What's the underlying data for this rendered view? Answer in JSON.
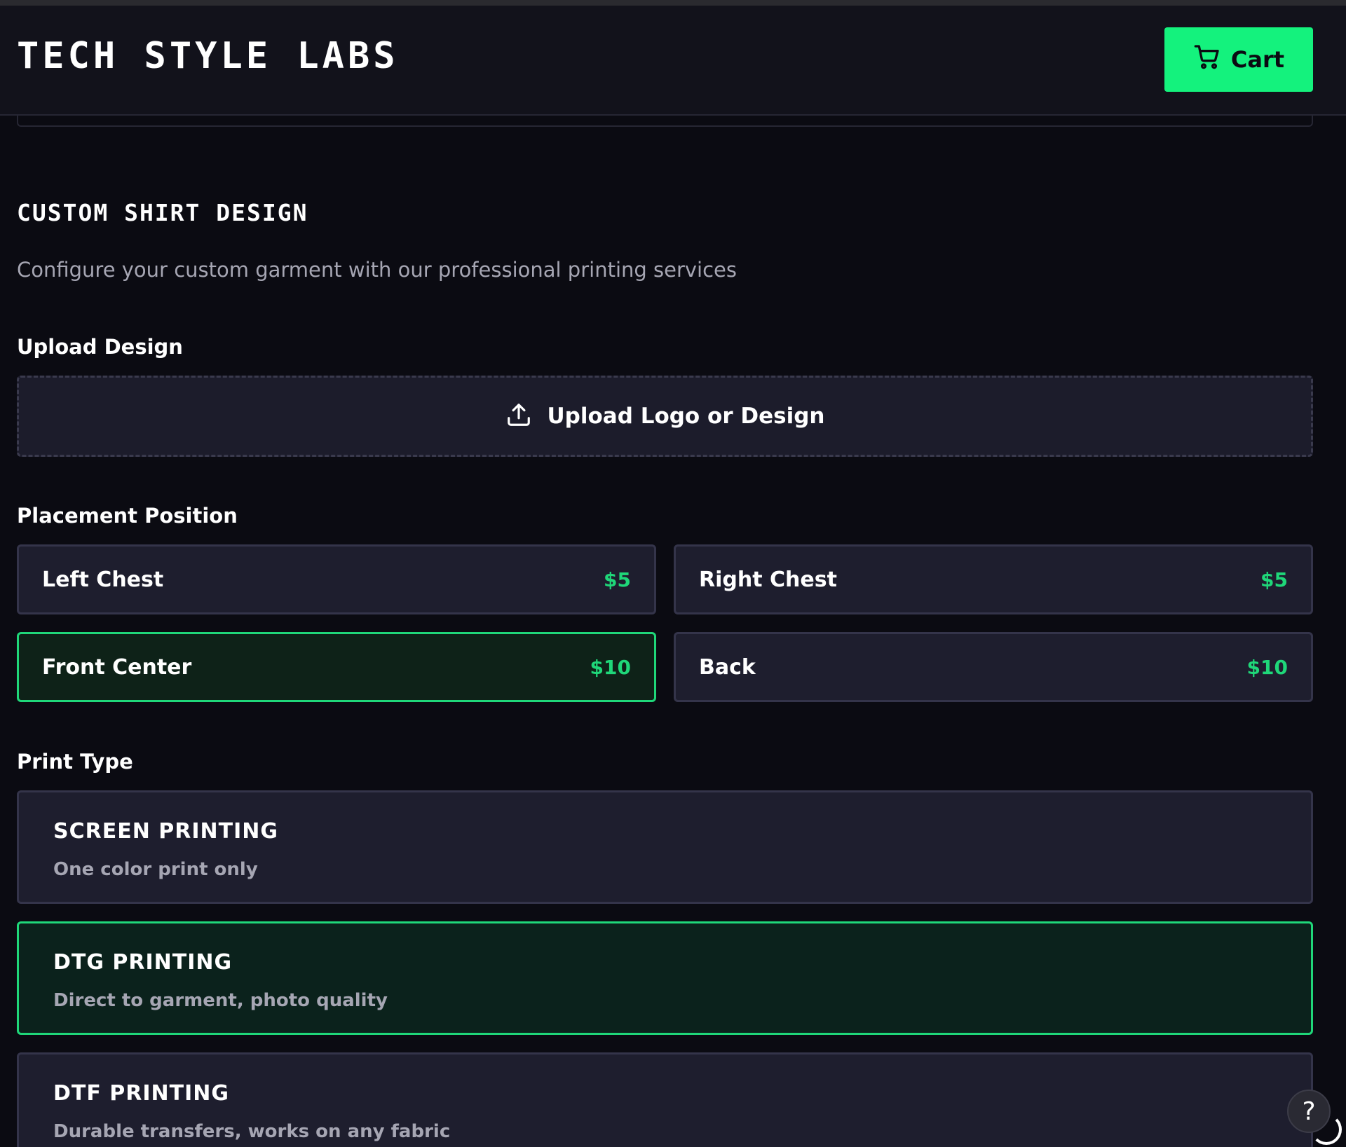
{
  "header": {
    "brand": "TECH STYLE LABS",
    "cart_label": "Cart",
    "cart_icon": "shopping-cart-icon"
  },
  "section": {
    "title": "CUSTOM SHIRT DESIGN",
    "subtitle": "Configure your custom garment with our professional printing services"
  },
  "upload": {
    "label": "Upload Design",
    "button_label": "Upload Logo or Design",
    "icon": "upload-icon"
  },
  "placement": {
    "label": "Placement Position",
    "options": [
      {
        "name": "Left Chest",
        "price": "$5",
        "selected": false
      },
      {
        "name": "Right Chest",
        "price": "$5",
        "selected": false
      },
      {
        "name": "Front Center",
        "price": "$10",
        "selected": true
      },
      {
        "name": "Back",
        "price": "$10",
        "selected": false
      }
    ]
  },
  "print_type": {
    "label": "Print Type",
    "options": [
      {
        "name": "SCREEN PRINTING",
        "description": "One color print only",
        "selected": false
      },
      {
        "name": "DTG PRINTING",
        "description": "Direct to garment, photo quality",
        "selected": true
      },
      {
        "name": "DTF PRINTING",
        "description": "Durable transfers, works on any fabric",
        "selected": false
      }
    ]
  },
  "help": {
    "label": "?",
    "icon": "help-icon"
  },
  "colors": {
    "accent": "#14f27d",
    "background": "#0b0b12",
    "card": "#1e1e2e",
    "selected_border": "#1fd779",
    "muted_text": "#a6a6b3"
  }
}
